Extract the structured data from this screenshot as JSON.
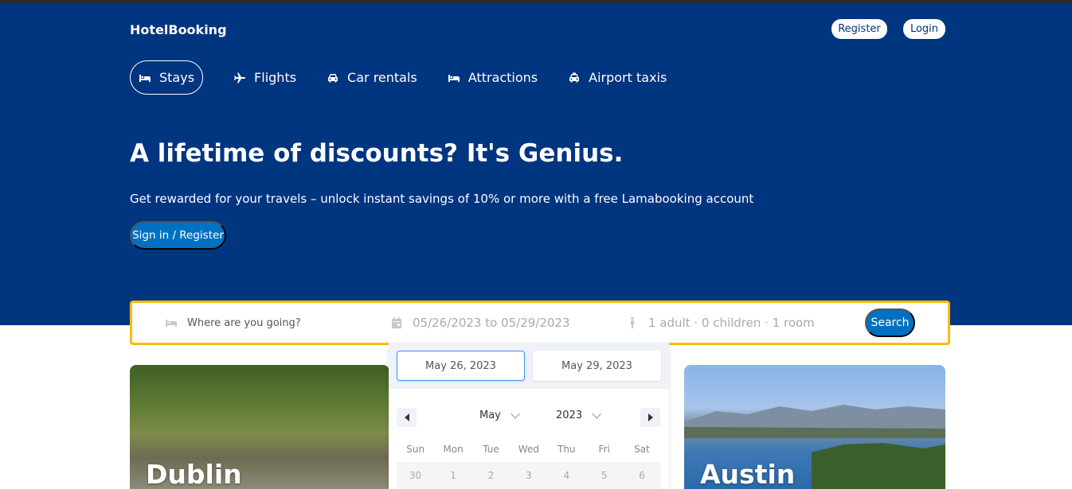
{
  "header": {
    "logo": "HotelBooking",
    "register_label": "Register",
    "login_label": "Login"
  },
  "nav": {
    "tabs": [
      {
        "label": "Stays",
        "icon": "bed-icon",
        "active": true
      },
      {
        "label": "Flights",
        "icon": "plane-icon",
        "active": false
      },
      {
        "label": "Car rentals",
        "icon": "car-icon",
        "active": false
      },
      {
        "label": "Attractions",
        "icon": "bed-icon",
        "active": false
      },
      {
        "label": "Airport taxis",
        "icon": "taxi-icon",
        "active": false
      }
    ]
  },
  "hero": {
    "title": "A lifetime of discounts? It's Genius.",
    "subtitle": "Get rewarded for your travels – unlock instant savings of 10% or more with a free Lamabooking account",
    "cta_label": "Sign in / Register"
  },
  "search": {
    "destination_placeholder": "Where are you going?",
    "dates_text": "05/26/2023 to 05/29/2023",
    "guests_text": "1 adult · 0 children · 1 room",
    "search_label": "Search"
  },
  "datepicker": {
    "start_date": "May 26, 2023",
    "end_date": "May 29, 2023",
    "month": "May",
    "year": "2023",
    "weekdays": [
      "Sun",
      "Mon",
      "Tue",
      "Wed",
      "Thu",
      "Fri",
      "Sat"
    ],
    "first_week": [
      "30",
      "1",
      "2",
      "3",
      "4",
      "5",
      "6"
    ]
  },
  "featured": {
    "cards": [
      {
        "name": "Dublin"
      },
      {
        "name": "Austin"
      }
    ]
  },
  "colors": {
    "brand_blue": "#003580",
    "accent_blue": "#0071c2",
    "search_border": "#febb02"
  }
}
